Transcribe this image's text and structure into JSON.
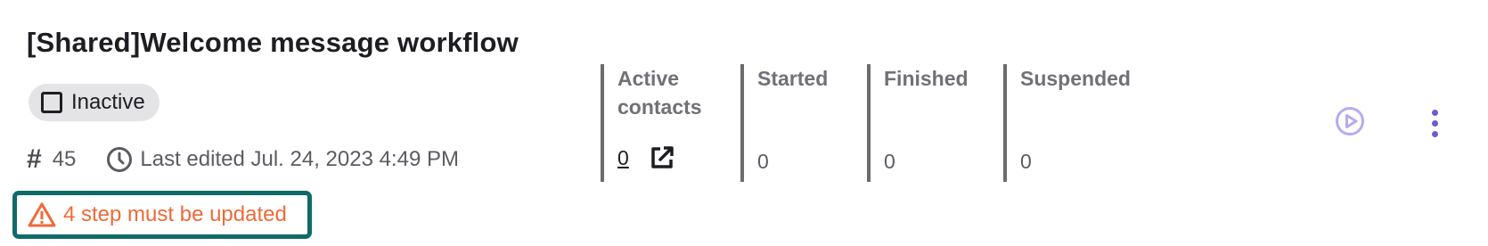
{
  "workflow": {
    "title": "[Shared]Welcome message workflow",
    "status": "Inactive",
    "id_symbol": "#",
    "id": "45",
    "last_edited": "Last edited Jul. 24, 2023 4:49 PM",
    "warning": "4 step must be updated"
  },
  "stats": [
    {
      "label": "Active contacts",
      "value": "0"
    },
    {
      "label": "Started",
      "value": "0"
    },
    {
      "label": "Finished",
      "value": "0"
    },
    {
      "label": "Suspended",
      "value": "0"
    }
  ],
  "icons": {
    "status": "square-icon",
    "id": "hash-icon",
    "time": "clock-icon",
    "warning": "warning-triangle-icon",
    "external": "external-link-icon",
    "play": "play-circle-icon",
    "more": "more-vertical-icon"
  },
  "colors": {
    "warning_text": "#ef6a3a",
    "warning_border": "#0f6b67",
    "accent": "#6a5fd0",
    "play": "#b5acef"
  }
}
